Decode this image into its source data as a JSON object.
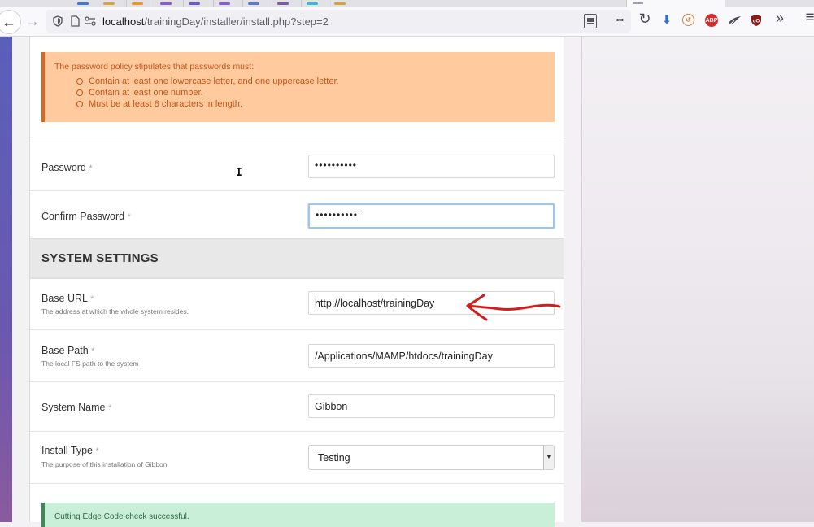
{
  "browser": {
    "url_host": "localhost",
    "url_path": "/trainingDay/installer/install.php?step=2",
    "tab_colors": [
      "#3a7bd5",
      "#d9a43a",
      "#e8962a",
      "#8a5ad5",
      "#6a5ad5",
      "#8a5ad5",
      "#5a7ad5",
      "#d8a03a",
      "#7a5aa5",
      "#33bbdd"
    ]
  },
  "notice": {
    "intro": "The password policy stipulates that passwords must:",
    "rules": [
      "Contain at least one lowercase letter, and one uppercase letter.",
      "Contain at least one number.",
      "Must be at least 8 characters in length."
    ]
  },
  "form": {
    "required_mark": "*",
    "password": {
      "label": "Password",
      "value": "••••••••••"
    },
    "confirm_password": {
      "label": "Confirm Password",
      "value": "••••••••••"
    },
    "section_title": "SYSTEM SETTINGS",
    "base_url": {
      "label": "Base URL",
      "description": "The address at which the whole system resides.",
      "value": "http://localhost/trainingDay"
    },
    "base_path": {
      "label": "Base Path",
      "description": "The local FS path to the system",
      "value": "/Applications/MAMP/htdocs/trainingDay"
    },
    "system_name": {
      "label": "System Name",
      "value": "Gibbon"
    },
    "install_type": {
      "label": "Install Type",
      "description": "The purpose of this installation of Gibbon",
      "value": "Testing"
    }
  },
  "success_message": "Cutting Edge Code check successful.",
  "icons": {
    "back": "←",
    "forward": "→",
    "more": "•••",
    "reload": "↻",
    "download": "⬇",
    "overflow": "»",
    "menu": "≡"
  }
}
